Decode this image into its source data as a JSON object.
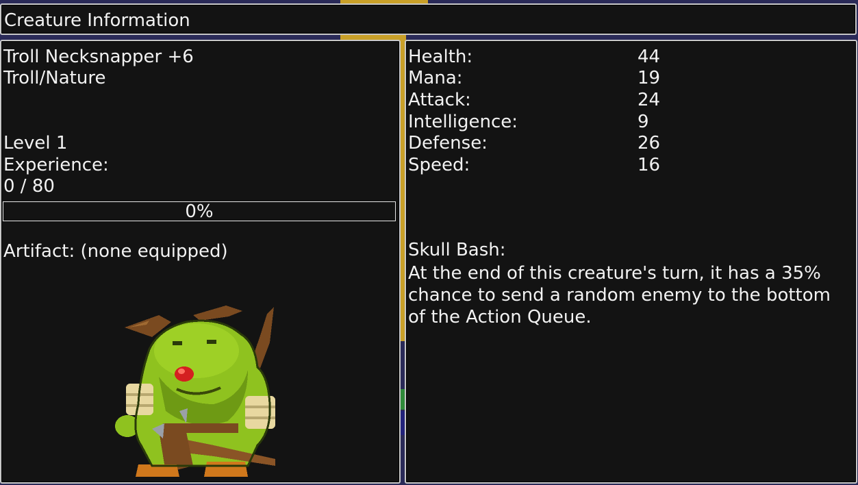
{
  "window": {
    "title": "Creature Information"
  },
  "creature": {
    "name": "Troll Necksnapper +6",
    "types": "Troll/Nature",
    "level": "Level 1",
    "experience_label": "Experience:",
    "experience_value": "0 / 80",
    "experience_progress": 0,
    "experience_percent_text": "0%",
    "artifact": "Artifact: (none equipped)",
    "portrait_icon": "troll-portrait-icon"
  },
  "stats": [
    {
      "label": "Health:",
      "value": "44"
    },
    {
      "label": "Mana:",
      "value": "19"
    },
    {
      "label": "Attack:",
      "value": "24"
    },
    {
      "label": "Intelligence:",
      "value": "9"
    },
    {
      "label": "Defense:",
      "value": "26"
    },
    {
      "label": "Speed:",
      "value": "16"
    }
  ],
  "ability": {
    "name": "Skull Bash:",
    "description": "At the end of this creature's turn, it has a 35% chance to send a random enemy to the bottom of the Action Queue."
  },
  "colors": {
    "panel_bg": "#131313",
    "panel_border": "#c8c8c8",
    "text": "#f2f2f2",
    "troll_skin": "#8fc21f"
  }
}
